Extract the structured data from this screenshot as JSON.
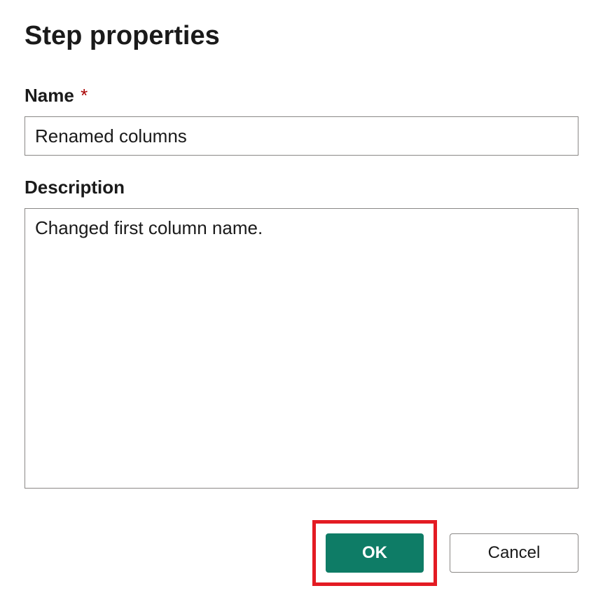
{
  "dialog": {
    "title": "Step properties"
  },
  "fields": {
    "name": {
      "label": "Name",
      "required_marker": "*",
      "value": "Renamed columns"
    },
    "description": {
      "label": "Description",
      "value": "Changed first column name."
    }
  },
  "buttons": {
    "ok_label": "OK",
    "cancel_label": "Cancel"
  },
  "colors": {
    "primary_button": "#0e7c66",
    "highlight_border": "#e31b23",
    "required_asterisk": "#a80000",
    "input_border": "#8a8886"
  }
}
